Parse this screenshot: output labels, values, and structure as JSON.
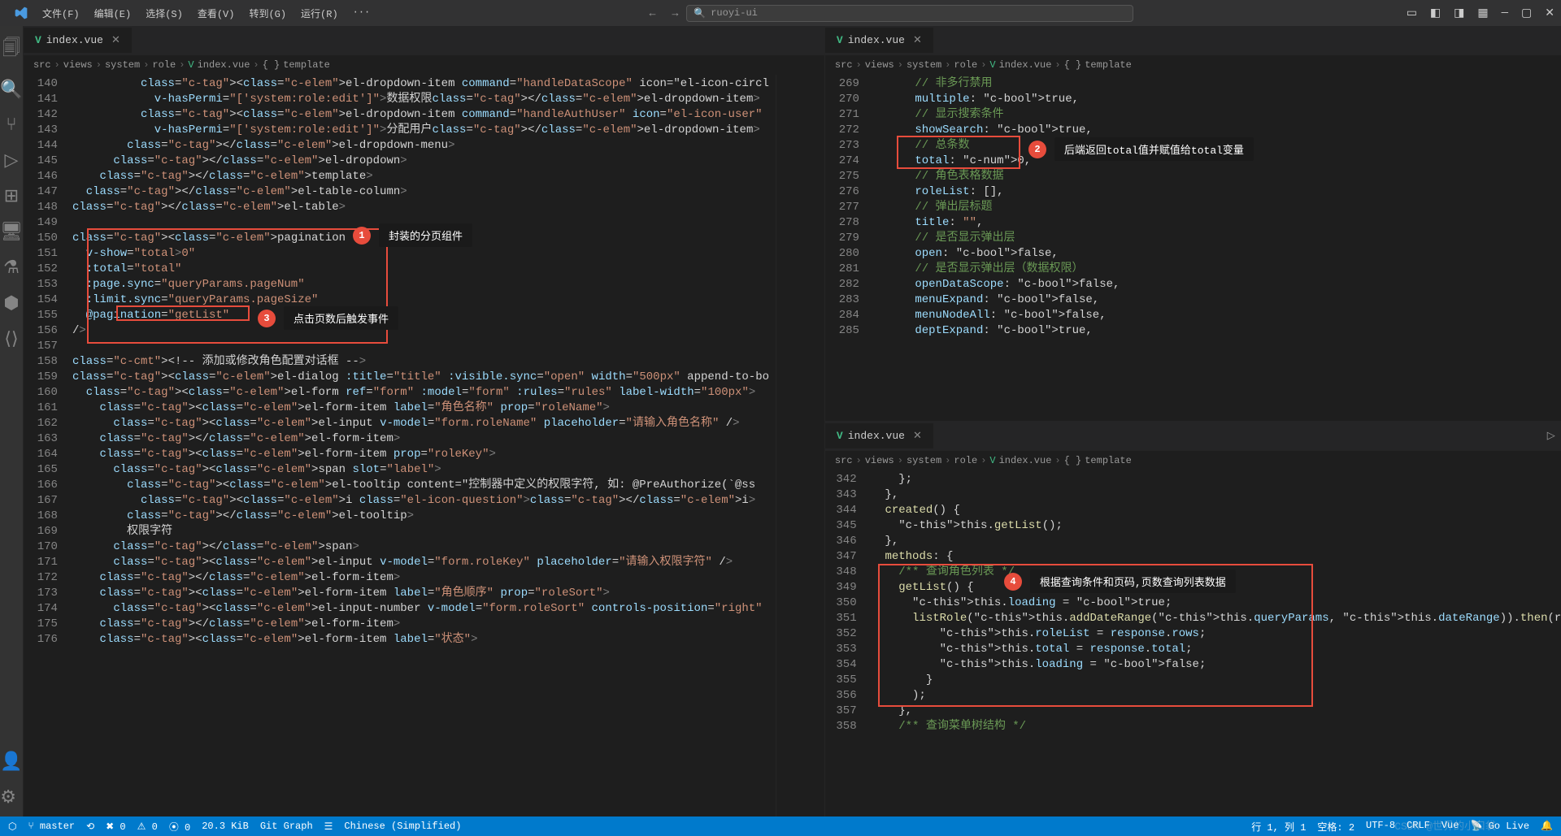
{
  "titlebar": {
    "menus": [
      "文件(F)",
      "编辑(E)",
      "选择(S)",
      "查看(V)",
      "转到(G)",
      "运行(R)",
      "···"
    ],
    "search_placeholder": "ruoyi-ui"
  },
  "tabs": {
    "left": "index.vue",
    "right_top": "index.vue",
    "right_bottom": "index.vue"
  },
  "breadcrumb": {
    "parts": [
      "src",
      "views",
      "system",
      "role",
      "index.vue",
      "template"
    ]
  },
  "callouts": {
    "c1": "封装的分页组件",
    "c2": "后端返回total值并赋值给total变量",
    "c3": "点击页数后触发事件",
    "c4": "根据查询条件和页码,页数查询列表数据"
  },
  "left_code": {
    "start": 140,
    "lines": [
      "          <el-dropdown-item command=\"handleDataScope\" icon=\"el-icon-circl",
      "            v-hasPermi=\"['system:role:edit']\">数据权限</el-dropdown-item>",
      "          <el-dropdown-item command=\"handleAuthUser\" icon=\"el-icon-user\"",
      "            v-hasPermi=\"['system:role:edit']\">分配用户</el-dropdown-item>",
      "        </el-dropdown-menu>",
      "      </el-dropdown>",
      "    </template>",
      "  </el-table-column>",
      "</el-table>",
      "",
      "<pagination",
      "  v-show=\"total>0\"",
      "  :total=\"total\"",
      "  :page.sync=\"queryParams.pageNum\"",
      "  :limit.sync=\"queryParams.pageSize\"",
      "  @pagination=\"getList\"",
      "/>",
      "",
      "<!-- 添加或修改角色配置对话框 -->",
      "<el-dialog :title=\"title\" :visible.sync=\"open\" width=\"500px\" append-to-bo",
      "  <el-form ref=\"form\" :model=\"form\" :rules=\"rules\" label-width=\"100px\">",
      "    <el-form-item label=\"角色名称\" prop=\"roleName\">",
      "      <el-input v-model=\"form.roleName\" placeholder=\"请输入角色名称\" />",
      "    </el-form-item>",
      "    <el-form-item prop=\"roleKey\">",
      "      <span slot=\"label\">",
      "        <el-tooltip content=\"控制器中定义的权限字符, 如: @PreAuthorize(`@ss",
      "          <i class=\"el-icon-question\"></i>",
      "        </el-tooltip>",
      "        权限字符",
      "      </span>",
      "      <el-input v-model=\"form.roleKey\" placeholder=\"请输入权限字符\" />",
      "    </el-form-item>",
      "    <el-form-item label=\"角色顺序\" prop=\"roleSort\">",
      "      <el-input-number v-model=\"form.roleSort\" controls-position=\"right\"",
      "    </el-form-item>",
      "    <el-form-item label=\"状态\">"
    ]
  },
  "right_top_code": {
    "start": 269,
    "lines": [
      "      // 非多行禁用",
      "      multiple: true,",
      "      // 显示搜索条件",
      "      showSearch: true,",
      "      // 总条数",
      "      total: 0,",
      "      // 角色表格数据",
      "      roleList: [],",
      "      // 弹出层标题",
      "      title: \"\",",
      "      // 是否显示弹出层",
      "      open: false,",
      "      // 是否显示弹出层（数据权限）",
      "      openDataScope: false,",
      "      menuExpand: false,",
      "      menuNodeAll: false,",
      "      deptExpand: true,"
    ]
  },
  "right_bottom_code": {
    "start": 342,
    "lines": [
      "    };",
      "  },",
      "  created() {",
      "    this.getList();",
      "  },",
      "  methods: {",
      "    /** 查询角色列表 */",
      "    getList() {",
      "      this.loading = true;",
      "      listRole(this.addDateRange(this.queryParams, this.dateRange)).then(resp",
      "          this.roleList = response.rows;",
      "          this.total = response.total;",
      "          this.loading = false;",
      "        }",
      "      );",
      "    },",
      "    /** 查询菜单树结构 */"
    ]
  },
  "statusbar": {
    "branch": "master",
    "sync": "⟲",
    "errors": "✖ 0",
    "warnings": "⚠ 0",
    "radio": "⦿ 0",
    "size": "20.3 KiB",
    "git_graph": "Git Graph",
    "lang_pack": "Chinese (Simplified)",
    "position": "行 1, 列 1",
    "spaces": "空格: 2",
    "encoding": "UTF-8",
    "eol": "CRLF",
    "lang": "Vue",
    "golive": "Go Live"
  },
  "watermark": "CSDN @世界的小口袋"
}
